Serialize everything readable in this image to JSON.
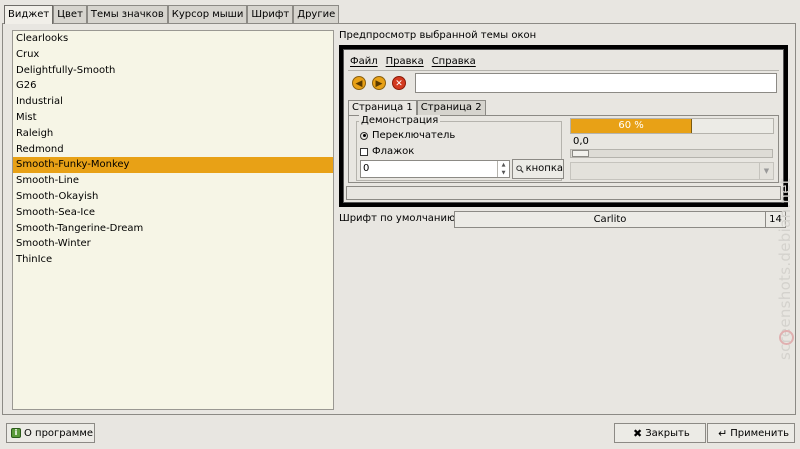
{
  "tabs": [
    "Виджет",
    "Цвет",
    "Темы значков",
    "Курсор мыши",
    "Шрифт",
    "Другие"
  ],
  "theme_list": {
    "items": [
      "Clearlooks",
      "Crux",
      "Delightfully-Smooth",
      "G26",
      "Industrial",
      "Mist",
      "Raleigh",
      "Redmond",
      "Smooth-Funky-Monkey",
      "Smooth-Line",
      "Smooth-Okayish",
      "Smooth-Sea-Ice",
      "Smooth-Tangerine-Dream",
      "Smooth-Winter",
      "ThinIce"
    ],
    "selected": "Smooth-Funky-Monkey"
  },
  "preview": {
    "label": "Предпросмотр выбранной темы окон",
    "menu": [
      "Файл",
      "Правка",
      "Справка"
    ],
    "tabs": [
      "Страница 1",
      "Страница 2"
    ],
    "group_label": "Демонстрация",
    "radio_label": "Переключатель",
    "check_label": "Флажок",
    "spin_value": "0",
    "button_label": "кнопка",
    "progress_text": "60 %",
    "progress_value": 0.6,
    "scale_value": "0,0"
  },
  "font": {
    "label": "Шрифт по умолчанию:",
    "name": "Carlito",
    "size": "14"
  },
  "buttons": {
    "about": "О программе",
    "close": "Закрыть",
    "apply": "Применить"
  },
  "watermark": "screenshots.debian.net",
  "colors": {
    "accent": "#e8a116",
    "list_bg": "#f6f5e6",
    "window_bg": "#e8e6e1"
  }
}
